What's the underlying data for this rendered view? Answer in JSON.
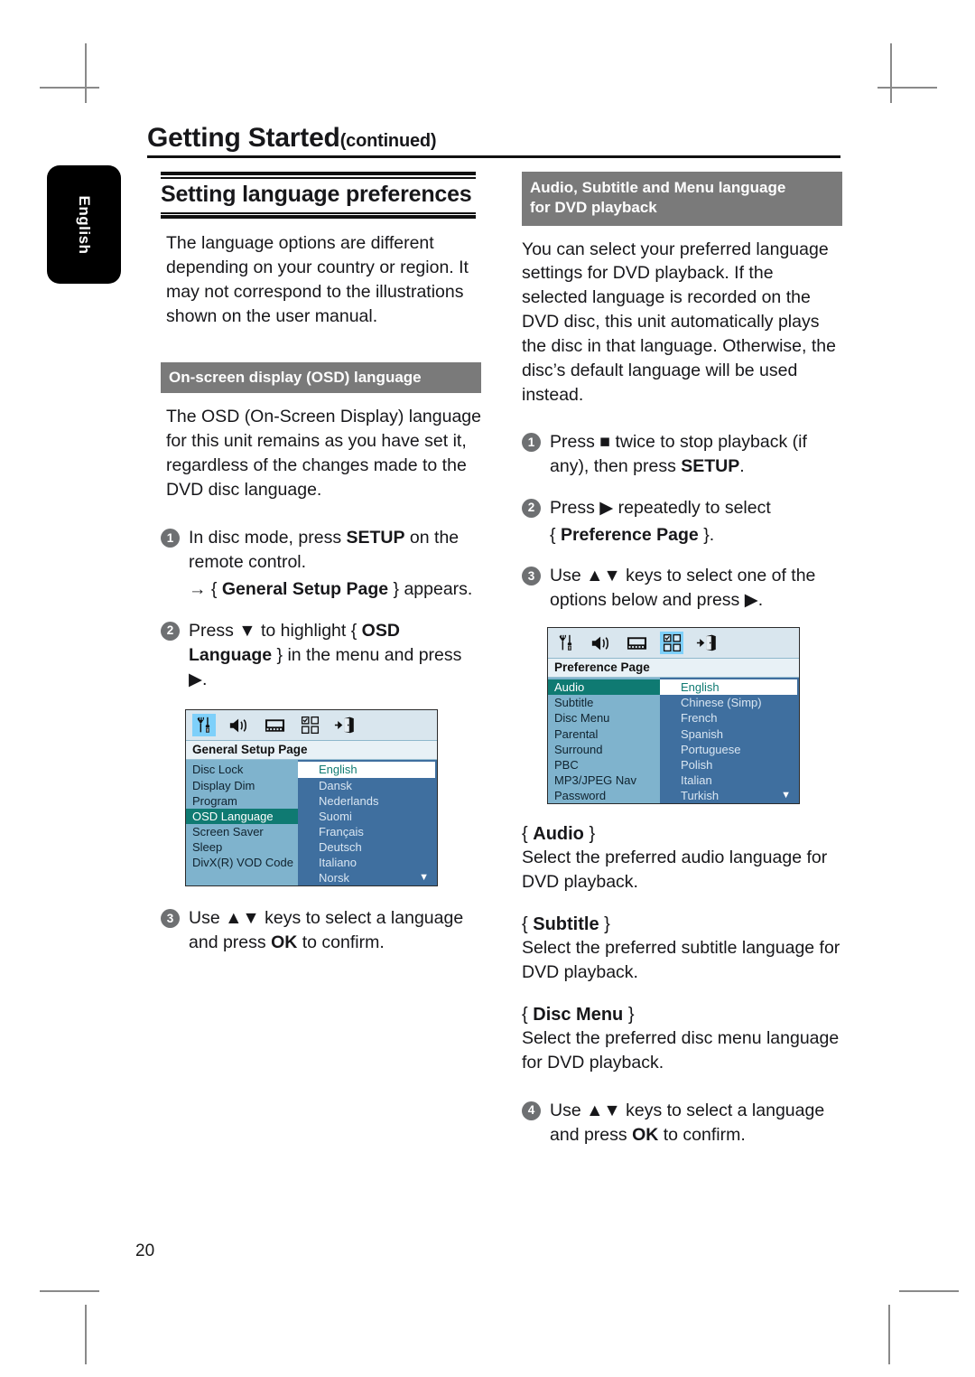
{
  "document": {
    "chapter_title": "Getting Started",
    "chapter_continued": "(continued)",
    "side_tab": "English",
    "page_number": "20"
  },
  "left_column": {
    "heading": "Setting language preferences",
    "intro": "The language options are different depending on your country or region. It may not correspond to the illustrations shown on the user manual.",
    "subheader": "On-screen display (OSD) language",
    "paragraph": "The OSD (On-Screen Display) language for this unit remains as you have set it, regardless of the changes made to the DVD disc language.",
    "steps": [
      {
        "num": "1",
        "text_pre": "In disc mode, press ",
        "bold": "SETUP",
        "text_post": " on the remote control.",
        "arrow_line_pre": "→ { ",
        "arrow_line_bold": "General Setup Page",
        "arrow_line_post": " } appears."
      },
      {
        "num": "2",
        "text_pre": "Press ▼ to highlight { ",
        "bold": "OSD Language",
        "text_post": " } in the menu and press ▶."
      },
      {
        "num": "3",
        "text_pre": "Use ▲▼ keys to select a language and press ",
        "bold": "OK",
        "text_post": " to confirm."
      }
    ],
    "osd_screen": {
      "title": "General Setup Page",
      "selected_icon_index": 0,
      "icons": [
        "tools-icon",
        "speaker-icon",
        "film-icon",
        "grid-icon",
        "exit-icon"
      ],
      "menu_items": [
        "Disc Lock",
        "Display Dim",
        "Program",
        "OSD Language",
        "Screen Saver",
        "Sleep",
        "DivX(R) VOD Code"
      ],
      "highlighted_menu_item": "OSD Language",
      "options": [
        "English",
        "Dansk",
        "Nederlands",
        "Suomi",
        "Français",
        "Deutsch",
        "Italiano",
        "Norsk"
      ],
      "selected_option": "English",
      "scroll_arrow": "▼"
    }
  },
  "right_column": {
    "subheader_line1": "Audio, Subtitle and Menu language",
    "subheader_line2": "for DVD playback",
    "paragraph": "You can select your preferred language settings for DVD playback. If the selected language is recorded on the DVD disc, this unit automatically plays the disc in that language. Otherwise, the disc’s default language will be used instead.",
    "steps": [
      {
        "num": "1",
        "text_pre": "Press ■ twice to stop playback (if any), then press ",
        "bold": "SETUP",
        "text_post": "."
      },
      {
        "num": "2",
        "text_pre": "Press ▶ repeatedly to select",
        "sub_pre": "{ ",
        "sub_bold": "Preference Page",
        "sub_post": " }."
      },
      {
        "num": "3",
        "text_pre": "Use ▲▼ keys to select one of the options below and press ▶."
      },
      {
        "num": "4",
        "text_pre": "Use ▲▼ keys to select a language and press ",
        "bold": "OK",
        "text_post": " to confirm."
      }
    ],
    "osd_screen": {
      "title": "Preference Page",
      "selected_icon_index": 3,
      "icons": [
        "tools-icon",
        "speaker-icon",
        "film-icon",
        "grid-icon",
        "exit-icon"
      ],
      "menu_items": [
        "Audio",
        "Subtitle",
        "Disc Menu",
        "Parental",
        "Surround",
        "PBC",
        "MP3/JPEG Nav",
        "Password"
      ],
      "highlighted_menu_item": "Audio",
      "options": [
        "English",
        "Chinese (Simp)",
        "French",
        "Spanish",
        "Portuguese",
        "Polish",
        "Italian",
        "Turkish"
      ],
      "selected_option": "English",
      "scroll_arrow": "▼"
    },
    "terms": [
      {
        "open": "{ ",
        "name": "Audio",
        "close": " }",
        "desc": "Select the preferred audio language for DVD playback."
      },
      {
        "open": "{ ",
        "name": "Subtitle",
        "close": " }",
        "desc": "Select the preferred subtitle language for DVD playback."
      },
      {
        "open": "{ ",
        "name": "Disc Menu",
        "close": " }",
        "desc": "Select the preferred disc menu language for DVD playback."
      }
    ]
  },
  "colors": {
    "subheader_gray": "#7a7a7a",
    "osd_left_panel": "#7fb3cd",
    "osd_right_panel": "#3f6f9f",
    "osd_highlight_teal": "#0f7a72",
    "osd_icon_selected": "#7ed0fa",
    "step_badge": "#6e7072"
  }
}
